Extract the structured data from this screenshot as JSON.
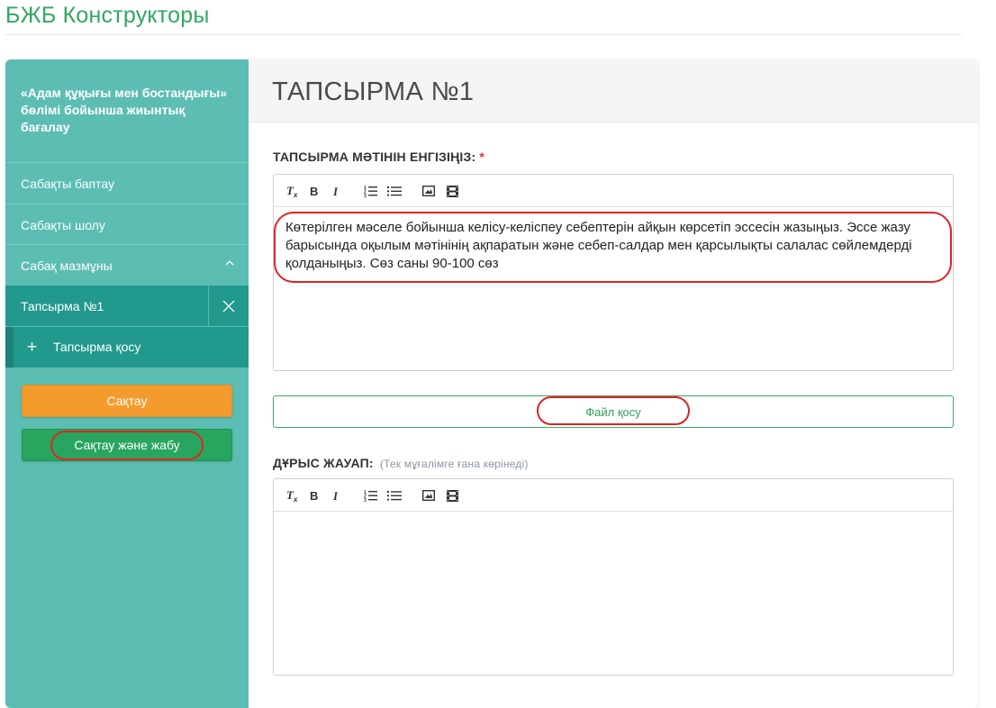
{
  "header": {
    "title": "БЖБ Конструкторы"
  },
  "sidebar": {
    "title": "«Адам құқығы мен бостандығы» бөлімі бойынша жиынтық бағалау",
    "items": [
      {
        "label": "Сабақты баптау"
      },
      {
        "label": "Сабақты шолу"
      },
      {
        "label": "Сабақ мазмұны"
      }
    ],
    "active_item": {
      "label": "Тапсырма №1"
    },
    "add_task": {
      "label": "Тапсырма қосу"
    },
    "save_label": "Сақтау",
    "save_close_label": "Сақтау және жабу"
  },
  "main": {
    "title": "ТАПСЫРМА №1",
    "task_label": "ТАПСЫРМА МӘТІНІН ЕНГІЗІҢІЗ:",
    "required_mark": "*",
    "task_text": "Көтерілген мәселе бойынша келісу-келіспеу себептерін айқын көрсетіп эссесін жазыңыз. Эссе жазу барысында оқылым мәтінінің ақпаратын және себеп-салдар мен қарсылықты салалас сөйлемдерді қолданыңыз. Сөз саны 90-100 сөз",
    "file_button_label": "Файл қосу",
    "answer_label": "ДҰРЫС ЖАУАП:",
    "answer_hint": "(Тек мұғалімге ғана көрінеді)",
    "answer_text": ""
  },
  "icons": {
    "toolbar": [
      "clear-format-icon",
      "bold-icon",
      "italic-icon",
      "ordered-list-icon",
      "bullet-list-icon",
      "image-icon",
      "video-icon"
    ],
    "sidebar": [
      "chevron-up-icon",
      "close-icon",
      "plus-icon"
    ]
  },
  "colors": {
    "brand_green": "#2fa860",
    "sidebar_bg": "#5cbdb3",
    "sidebar_active": "#21998d",
    "save_orange": "#f39c2d",
    "save_close_green": "#28a55f",
    "highlight_red": "#e02424"
  }
}
